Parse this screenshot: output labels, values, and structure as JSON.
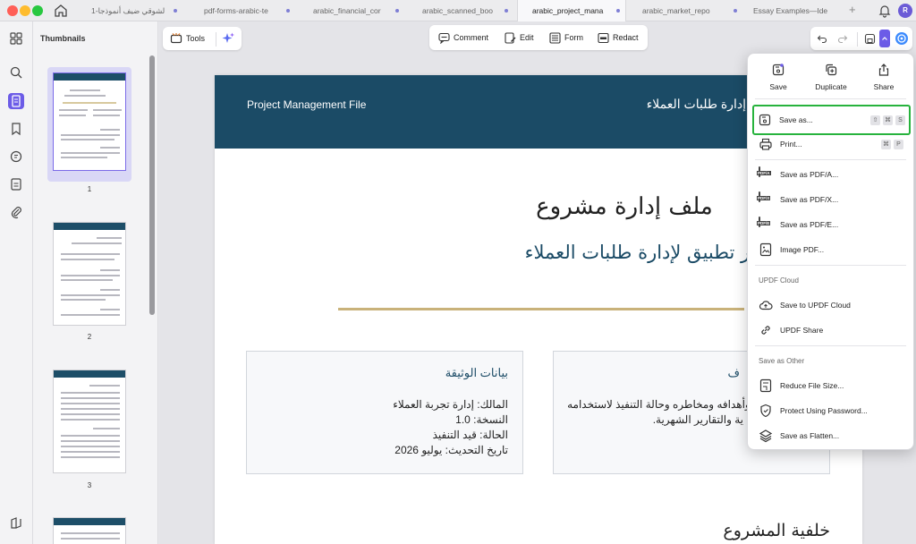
{
  "tabs": [
    {
      "label": "لشوقي ضيف أنموذجا-1",
      "active": false
    },
    {
      "label": "pdf-forms-arabic-te",
      "active": false
    },
    {
      "label": "arabic_financial_cor",
      "active": false
    },
    {
      "label": "arabic_scanned_boo",
      "active": false
    },
    {
      "label": "arabic_project_mana",
      "active": true
    },
    {
      "label": "arabic_market_repo",
      "active": false
    },
    {
      "label": "Essay Examples—Ide",
      "active": false
    }
  ],
  "user": {
    "avatar_initial": "R"
  },
  "thumbnails": {
    "title": "Thumbnails",
    "pages": [
      {
        "label": "1"
      },
      {
        "label": "2"
      },
      {
        "label": "3"
      }
    ]
  },
  "toolbar": {
    "tools_label": "Tools",
    "comment_label": "Comment",
    "edit_label": "Edit",
    "form_label": "Form",
    "redact_label": "Redact"
  },
  "document": {
    "header_left": "Project Management File",
    "header_right": "إدارة طلبات العملاء",
    "title": "ملف إدارة مشروع",
    "subtitle": "تطوير تطبيق لإدارة طلبات العملاء",
    "card1": {
      "title": "بيانات الوثيقة",
      "rows": [
        "المالك: إدارة تجربة العملاء",
        "النسخة: 1.0",
        "الحالة: قيد التنفيذ",
        "تاريخ التحديث: يوليو 2026"
      ]
    },
    "card2": {
      "title_fragment": "ف",
      "line1": "وع وأهدافه ومخاطره وحالة التنفيذ لاستخدامه",
      "line2": "ية والتقارير الشهرية."
    },
    "section_title": "خلفية المشروع"
  },
  "menu": {
    "quick_actions": [
      {
        "label": "Save",
        "icon": "save-icon"
      },
      {
        "label": "Duplicate",
        "icon": "duplicate-icon"
      },
      {
        "label": "Share",
        "icon": "share-icon"
      }
    ],
    "save_as": {
      "label": "Save as...",
      "shortcut": [
        "⇧",
        "⌘",
        "S"
      ]
    },
    "print": {
      "label": "Print...",
      "shortcut": [
        "⌘",
        "P"
      ]
    },
    "pdf_formats": [
      {
        "label": "Save as PDF/A...",
        "badge": "PDF/A"
      },
      {
        "label": "Save as PDF/X...",
        "badge": "PDF/X"
      },
      {
        "label": "Save as PDF/E...",
        "badge": "PDF/E"
      }
    ],
    "image_pdf": "Image PDF...",
    "cloud_section": "UPDF Cloud",
    "cloud_items": [
      {
        "label": "Save to UPDF Cloud",
        "icon": "cloud-upload-icon"
      },
      {
        "label": "UPDF Share",
        "icon": "link-icon"
      }
    ],
    "other_section": "Save as Other",
    "other_items": [
      {
        "label": "Reduce File Size...",
        "icon": "compress-icon"
      },
      {
        "label": "Protect Using Password...",
        "icon": "shield-icon"
      },
      {
        "label": "Save as Flatten...",
        "icon": "layers-icon"
      }
    ]
  },
  "colors": {
    "accent": "#6c5ce7",
    "header_blue": "#1b4b66",
    "gold_rule": "#c9b27a",
    "highlight_green": "#27b33d"
  }
}
